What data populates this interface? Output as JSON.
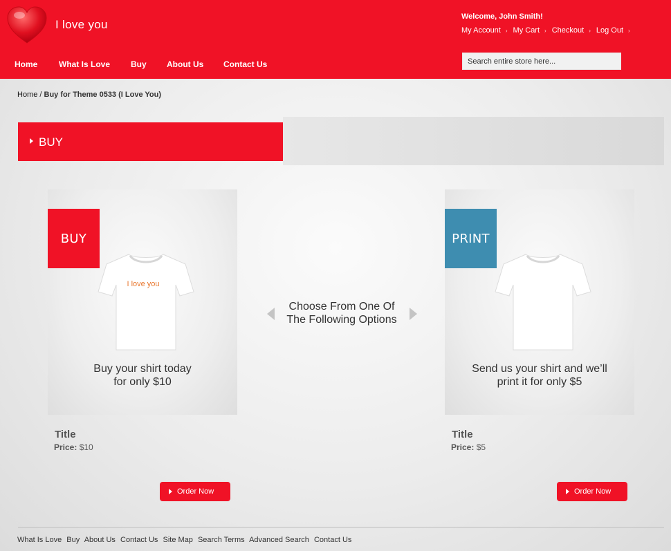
{
  "header": {
    "logo_text": "I love you",
    "welcome": "Welcome, John Smith!",
    "account_links": [
      "My Account",
      "My Cart",
      "Checkout",
      "Log Out"
    ],
    "search_placeholder": "Search entire store here...",
    "nav": [
      "Home",
      "What Is Love",
      "Buy",
      "About Us",
      "Contact Us"
    ]
  },
  "breadcrumb": {
    "home": "Home",
    "separator": " / ",
    "current": "Buy for Theme 0533 (I Love You)"
  },
  "page_title": "BUY",
  "options_text_line1": "Choose From One Of",
  "options_text_line2": "The Following Options",
  "products": [
    {
      "tag": "BUY",
      "shirt_print": "I love you",
      "caption_line1": "Buy your shirt today",
      "caption_line2": "for only $10",
      "title": "Title",
      "price_label": "Price:",
      "price": "$10",
      "button": "Order Now"
    },
    {
      "tag": "PRINT",
      "caption_line1": "Send us your shirt and we’ll",
      "caption_line2": "print it for only $5",
      "title": "Title",
      "price_label": "Price:",
      "price": "$5",
      "button": "Order Now"
    }
  ],
  "footer_links": [
    "What Is Love",
    "Buy",
    "About Us",
    "Contact Us",
    "Site Map",
    "Search Terms",
    "Advanced Search",
    "Contact Us"
  ],
  "colors": {
    "brand_red": "#f01226",
    "print_blue": "#3e8db0"
  },
  "icons": {
    "logo": "heart-icon",
    "link_separator": "chevron-right-icon",
    "carousel_prev": "arrow-left-icon",
    "carousel_next": "arrow-right-icon"
  }
}
